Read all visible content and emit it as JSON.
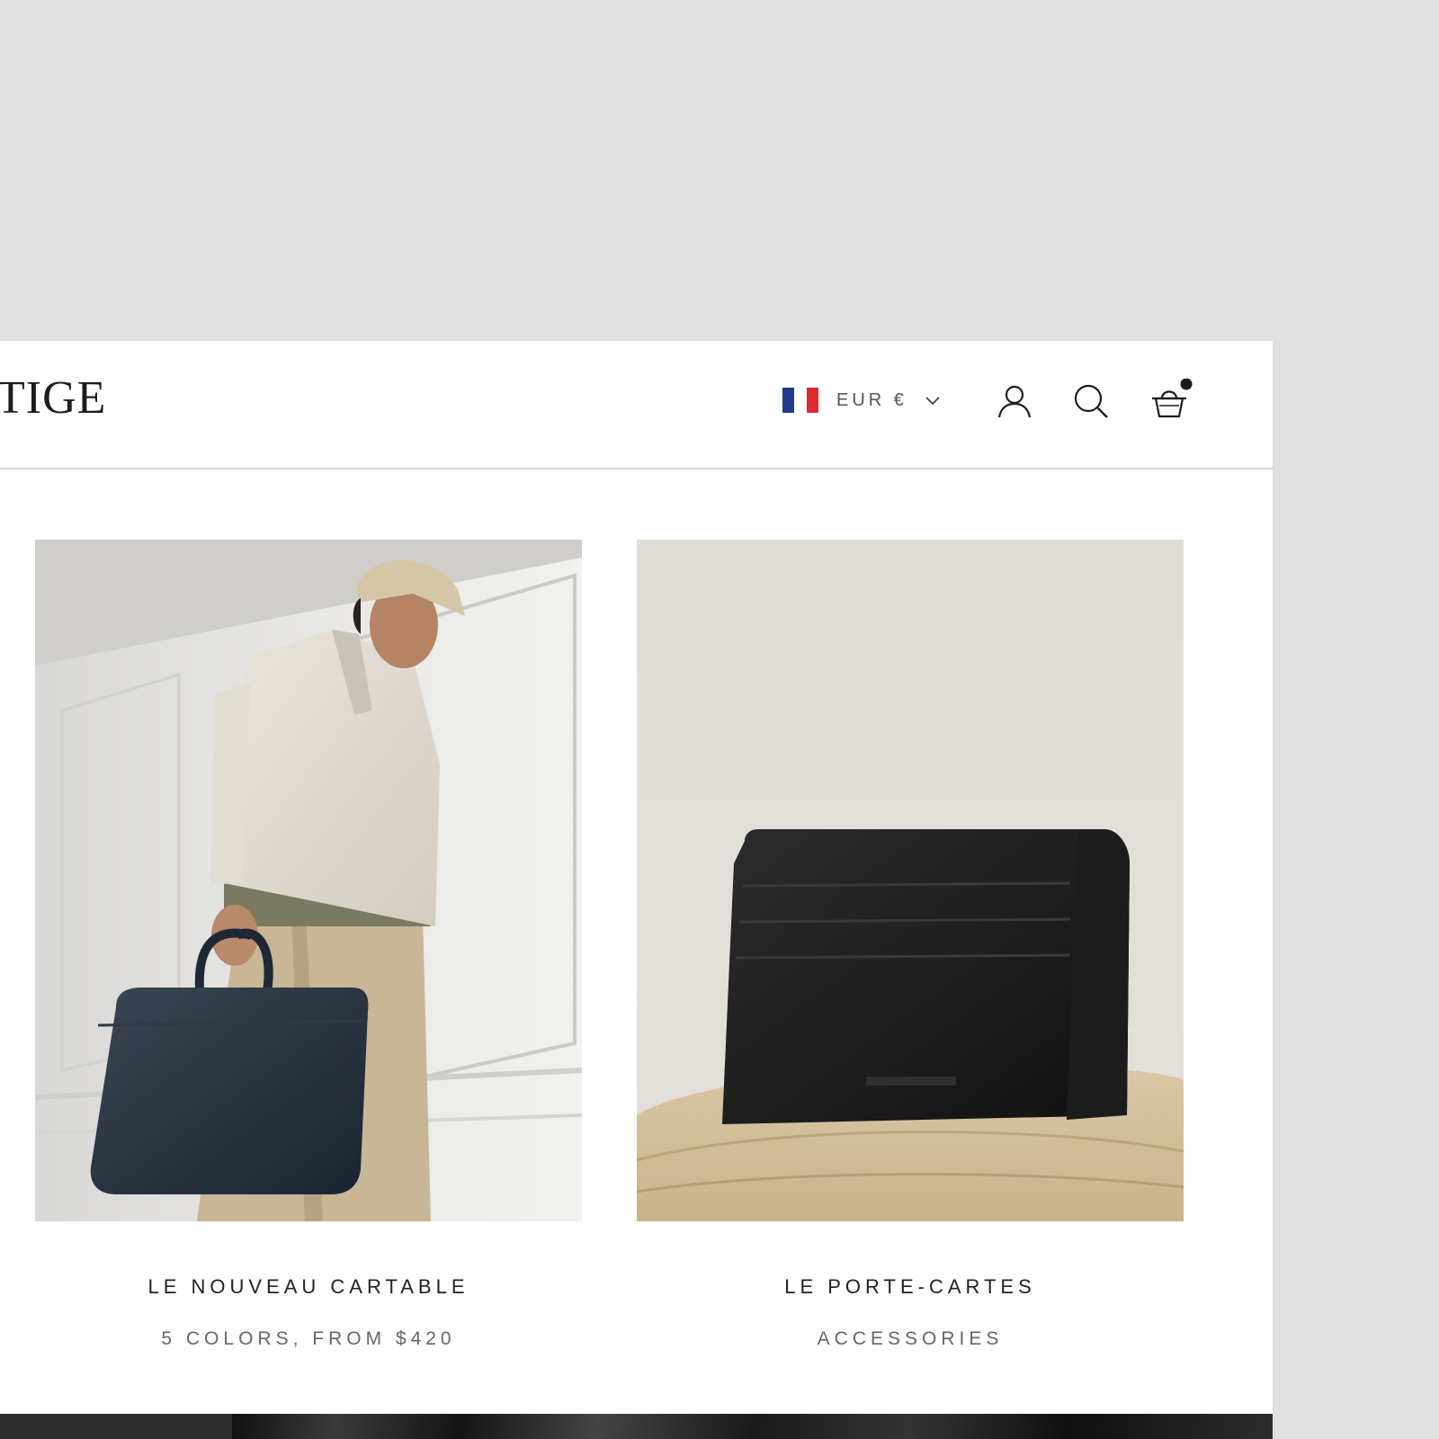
{
  "header": {
    "logo_text": "TIGE",
    "currency": {
      "label": "EUR €",
      "flag": "france-flag",
      "flag_colors": [
        "#1f3a8f",
        "#ffffff",
        "#e1272f"
      ]
    },
    "icons": [
      "user-icon",
      "search-icon",
      "basket-icon"
    ],
    "cart_has_items": true
  },
  "products": [
    {
      "title": "LE NOUVEAU CARTABLE",
      "subtitle": "5 COLORS, FROM $420",
      "image": "man-holding-navy-leather-briefcase"
    },
    {
      "title": "LE PORTE-CARTES",
      "subtitle": "ACCESSORIES",
      "image": "black-leather-card-holder"
    }
  ],
  "colors": {
    "background": "#e0e0e0",
    "window": "#ffffff",
    "text": "#222222",
    "muted": "#666666"
  }
}
